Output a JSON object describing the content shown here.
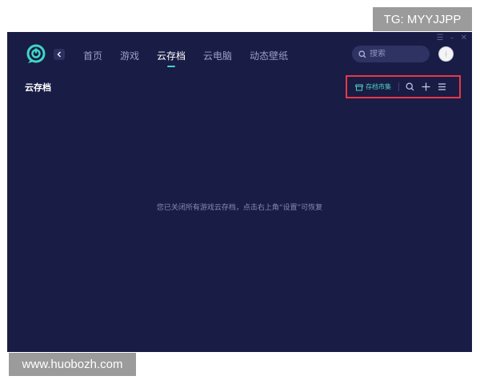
{
  "watermarks": {
    "top": "TG: MYYJJPP",
    "bottom": "www.huobozh.com"
  },
  "window_controls": {
    "menu": "☰",
    "minimize": "–",
    "close": "✕"
  },
  "nav": {
    "tabs": [
      {
        "label": "首页",
        "active": false
      },
      {
        "label": "游戏",
        "active": false
      },
      {
        "label": "云存档",
        "active": true
      },
      {
        "label": "云电脑",
        "active": false
      },
      {
        "label": "动态壁纸",
        "active": false
      }
    ]
  },
  "search": {
    "placeholder": "搜索"
  },
  "page": {
    "title": "云存档",
    "empty_message": "您已关闭所有游戏云存档，点击右上角“设置”可恢复"
  },
  "toolbar": {
    "market_label": "存档市集"
  },
  "colors": {
    "background": "#191c45",
    "accent": "#3fd6c6",
    "highlight_box": "#e63946"
  }
}
